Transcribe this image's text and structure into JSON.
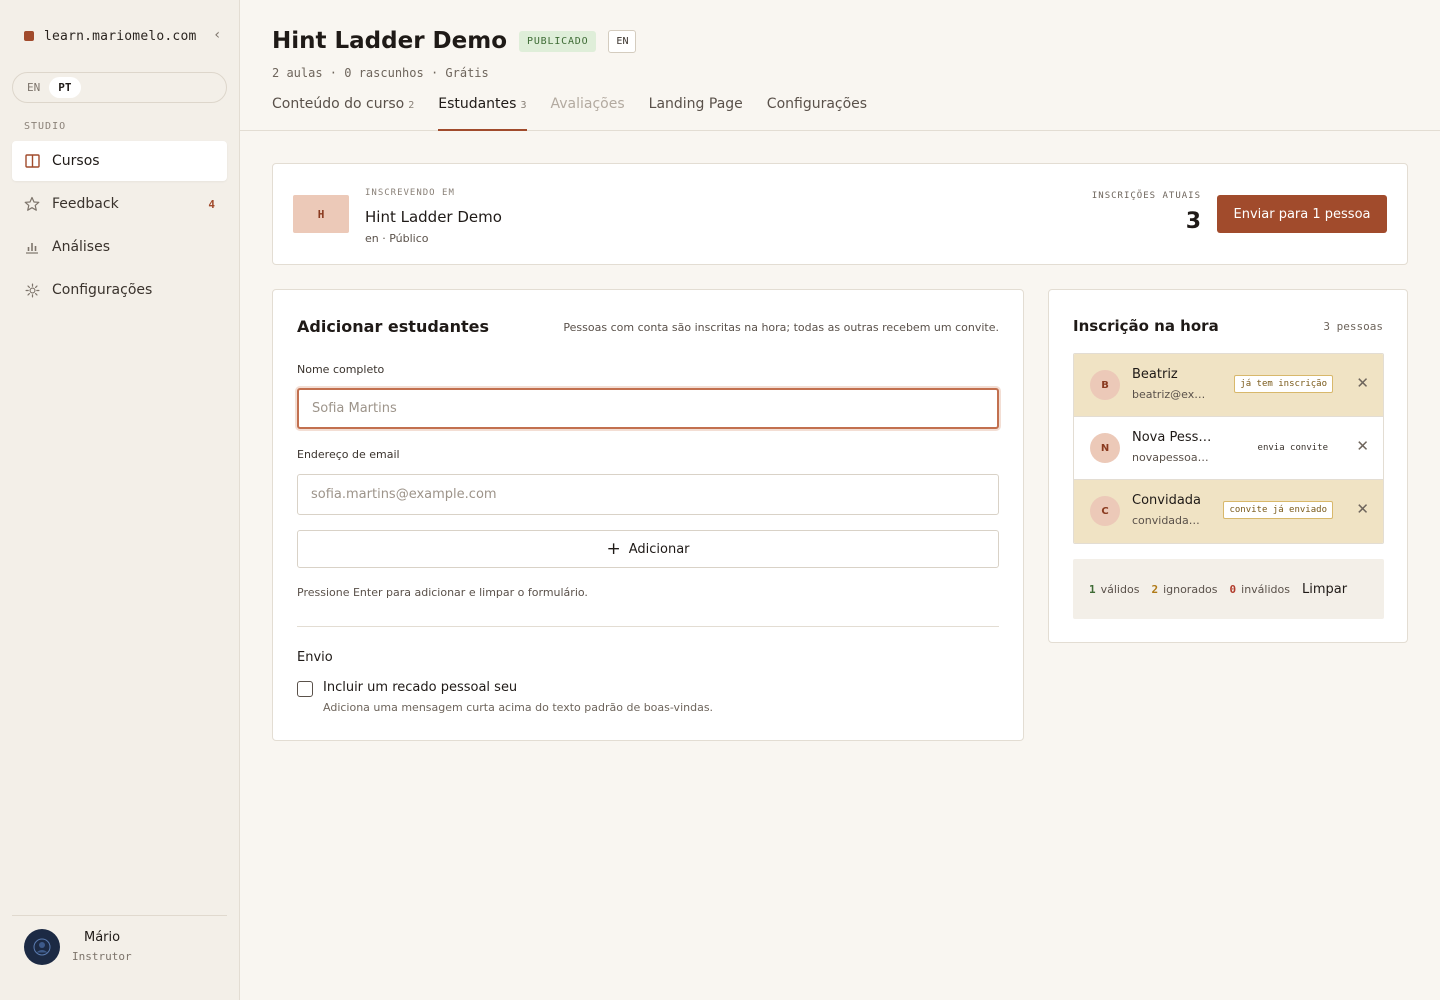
{
  "sidebar": {
    "site": "learn.mariomelo.com",
    "lang_en": "EN",
    "lang_pt": "PT",
    "section": "STUDIO",
    "items": [
      {
        "label": "Cursos",
        "icon": "book-icon"
      },
      {
        "label": "Feedback",
        "icon": "star-icon",
        "badge": "4"
      },
      {
        "label": "Análises",
        "icon": "bar-chart-icon"
      },
      {
        "label": "Configurações",
        "icon": "gear-icon"
      }
    ],
    "user": {
      "name": "Mário",
      "role": "Instrutor"
    }
  },
  "header": {
    "title": "Hint Ladder Demo",
    "status": "PUBLICADO",
    "lang": "EN",
    "meta": "2 aulas · 0 rascunhos · Grátis",
    "tabs": [
      {
        "label": "Conteúdo do curso",
        "count": "2"
      },
      {
        "label": "Estudantes",
        "count": "3"
      },
      {
        "label": "Avaliações",
        "count": ""
      },
      {
        "label": "Landing Page",
        "count": ""
      },
      {
        "label": "Configurações",
        "count": ""
      }
    ]
  },
  "enroll": {
    "thumb": "H",
    "label": "INSCREVENDO EM",
    "course": "Hint Ladder Demo",
    "meta": "en · Público",
    "current_label": "INSCRIÇÕES ATUAIS",
    "current_count": "3",
    "send_button": "Enviar para 1 pessoa"
  },
  "add": {
    "title": "Adicionar estudantes",
    "hint": "Pessoas com conta são inscritas na hora; todas as outras recebem um convite.",
    "name_label": "Nome completo",
    "name_placeholder": "Sofia Martins",
    "email_label": "Endereço de email",
    "email_placeholder": "sofia.martins@example.com",
    "add_button": "Adicionar",
    "enter_hint": "Pressione Enter para adicionar e limpar o formulário.",
    "send_title": "Envio",
    "check_label": "Incluir um recado pessoal seu",
    "check_desc": "Adiciona uma mensagem curta acima do texto padrão de boas-vindas."
  },
  "instant": {
    "title": "Inscrição na hora",
    "count": "3 pessoas",
    "rows": [
      {
        "initial": "B",
        "name": "Beatriz",
        "email": "beatriz@example.com",
        "tag": "já tem inscrição",
        "state": "warn"
      },
      {
        "initial": "N",
        "name": "Nova Pessoa",
        "email": "novapessoa@example.com",
        "tag": "envia convite",
        "state": "ok"
      },
      {
        "initial": "C",
        "name": "Convidada",
        "email": "convidada@example.com",
        "tag": "convite já enviado",
        "state": "warn"
      }
    ],
    "summary": {
      "valid_n": "1",
      "valid_label": "válidos",
      "ignored_n": "2",
      "ignored_label": "ignorados",
      "invalid_n": "0",
      "invalid_label": "inválidos",
      "clear": "Limpar"
    }
  },
  "colors": {
    "accent": "#a14b2c",
    "published": "#dfeed9",
    "warn_row": "#f0e3c4"
  }
}
